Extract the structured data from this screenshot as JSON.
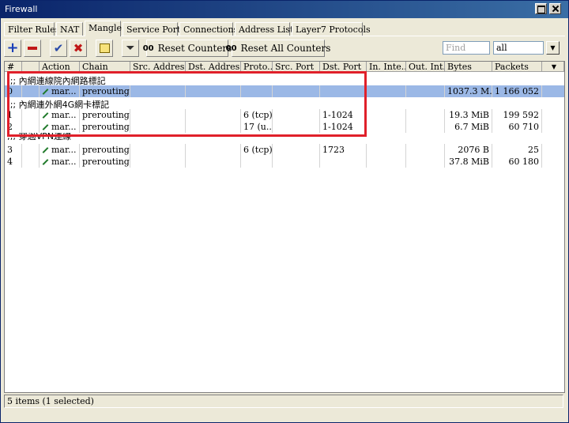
{
  "window": {
    "title": "Firewall"
  },
  "tabs": [
    {
      "label": "Filter Rules"
    },
    {
      "label": "NAT"
    },
    {
      "label": "Mangle"
    },
    {
      "label": "Service Ports"
    },
    {
      "label": "Connections"
    },
    {
      "label": "Address Lists"
    },
    {
      "label": "Layer7 Protocols"
    }
  ],
  "toolbar": {
    "reset_counters": "Reset Counters",
    "reset_all_counters": "Reset All Counters",
    "counter_glyph": "00",
    "find_placeholder": "Find",
    "filter_value": "all"
  },
  "columns": [
    "#",
    "",
    "Action",
    "Chain",
    "Src. Address",
    "Dst. Address",
    "Proto...",
    "Src. Port",
    "Dst. Port",
    "In. Inte...",
    "Out. Int...",
    "Bytes",
    "Packets"
  ],
  "rows": [
    {
      "type": "comment",
      "text": ";;; 內網連線院內網路標記"
    },
    {
      "type": "rule",
      "num": "0",
      "action": "mar...",
      "chain": "prerouting",
      "src": "",
      "dst": "",
      "proto": "",
      "sport": "",
      "dport": "",
      "in": "",
      "out": "",
      "bytes": "1037.3 M...",
      "packets": "1 166 052",
      "selected": true
    },
    {
      "type": "comment",
      "text": ";;; 內網連外網4G網卡標記"
    },
    {
      "type": "rule",
      "num": "1",
      "action": "mar...",
      "chain": "prerouting",
      "src": "",
      "dst": "",
      "proto": "6 (tcp)",
      "sport": "",
      "dport": "1-1024",
      "in": "",
      "out": "",
      "bytes": "19.3 MiB",
      "packets": "199 592"
    },
    {
      "type": "rule",
      "num": "2",
      "action": "mar...",
      "chain": "prerouting",
      "src": "",
      "dst": "",
      "proto": "17 (u...",
      "sport": "",
      "dport": "1-1024",
      "in": "",
      "out": "",
      "bytes": "6.7 MiB",
      "packets": "60 710"
    },
    {
      "type": "comment",
      "text": ";;; 穿過VPN連線"
    },
    {
      "type": "rule",
      "num": "3",
      "action": "mar...",
      "chain": "prerouting",
      "src": "",
      "dst": "",
      "proto": "6 (tcp)",
      "sport": "",
      "dport": "1723",
      "in": "",
      "out": "",
      "bytes": "2076 B",
      "packets": "25"
    },
    {
      "type": "rule",
      "num": "4",
      "action": "mar...",
      "chain": "prerouting",
      "src": "",
      "dst": "",
      "proto": "",
      "sport": "",
      "dport": "",
      "in": "",
      "out": "",
      "bytes": "37.8 MiB",
      "packets": "60 180"
    }
  ],
  "status": {
    "text": "5 items (1 selected)"
  }
}
